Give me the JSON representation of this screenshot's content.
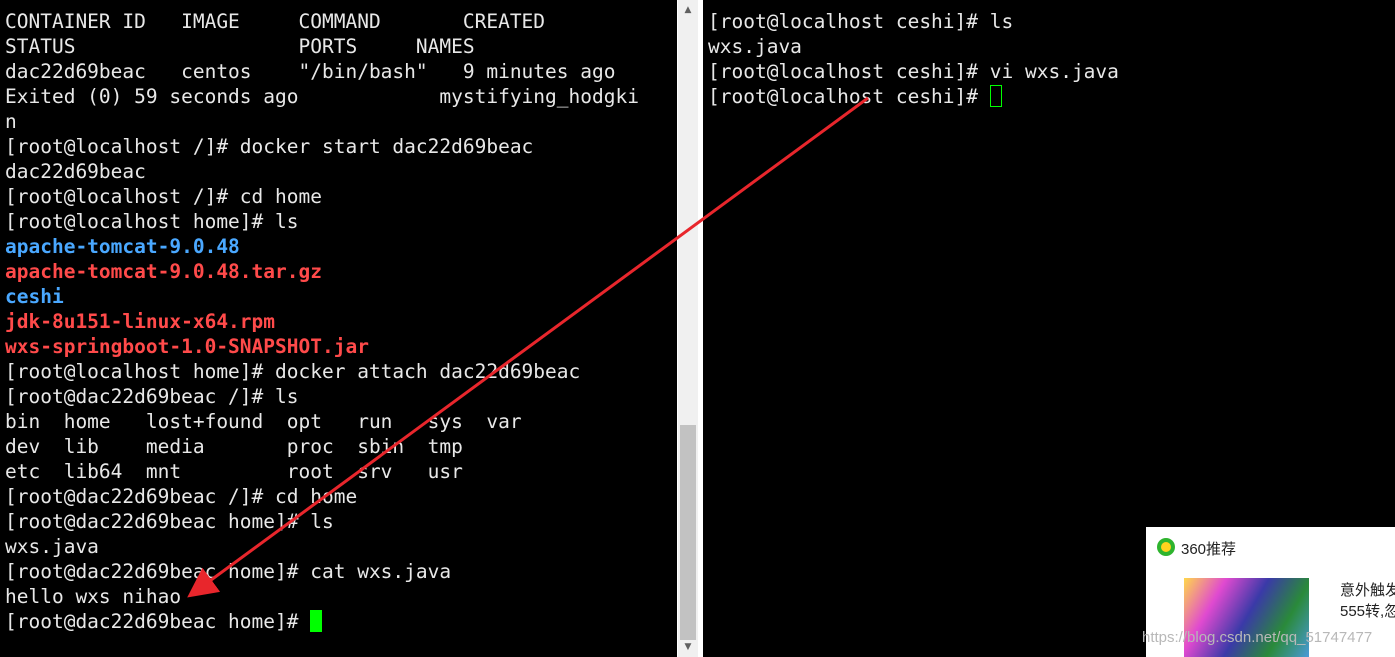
{
  "left_terminal": {
    "lines": [
      {
        "text": "CONTAINER ID   IMAGE     COMMAND       CREATED",
        "style": "normal"
      },
      {
        "text": "STATUS                   PORTS     NAMES",
        "style": "normal"
      },
      {
        "text": "dac22d69beac   centos    \"/bin/bash\"   9 minutes ago",
        "style": "normal"
      },
      {
        "text": "Exited (0) 59 seconds ago            mystifying_hodgki",
        "style": "normal"
      },
      {
        "text": "n",
        "style": "normal"
      },
      {
        "text": "[root@localhost /]# docker start dac22d69beac",
        "style": "normal"
      },
      {
        "text": "dac22d69beac",
        "style": "normal"
      },
      {
        "text": "[root@localhost /]# cd home",
        "style": "normal"
      },
      {
        "text": "[root@localhost home]# ls",
        "style": "normal"
      },
      {
        "text": "apache-tomcat-9.0.48",
        "style": "blue"
      },
      {
        "text": "apache-tomcat-9.0.48.tar.gz",
        "style": "red"
      },
      {
        "text": "ceshi",
        "style": "blue"
      },
      {
        "text": "jdk-8u151-linux-x64.rpm",
        "style": "red"
      },
      {
        "text": "wxs-springboot-1.0-SNAPSHOT.jar",
        "style": "red"
      },
      {
        "text": "[root@localhost home]# docker attach dac22d69beac",
        "style": "normal"
      },
      {
        "text": "[root@dac22d69beac /]# ls",
        "style": "normal"
      },
      {
        "text": "bin  home   lost+found  opt   run   sys  var",
        "style": "normal"
      },
      {
        "text": "dev  lib    media       proc  sbin  tmp",
        "style": "normal"
      },
      {
        "text": "etc  lib64  mnt         root  srv   usr",
        "style": "normal"
      },
      {
        "text": "[root@dac22d69beac /]# cd home",
        "style": "normal"
      },
      {
        "text": "[root@dac22d69beac home]# ls",
        "style": "normal"
      },
      {
        "text": "wxs.java",
        "style": "normal"
      },
      {
        "text": "[root@dac22d69beac home]# cat wxs.java",
        "style": "normal"
      },
      {
        "text": "hello wxs nihao",
        "style": "normal"
      },
      {
        "text": "[root@dac22d69beac home]# ",
        "style": "normal"
      }
    ]
  },
  "right_terminal": {
    "lines": [
      {
        "text": "[root@localhost ceshi]# ls",
        "style": "normal"
      },
      {
        "text": "wxs.java",
        "style": "normal"
      },
      {
        "text": "[root@localhost ceshi]# vi wxs.java",
        "style": "normal"
      },
      {
        "text": "[root@localhost ceshi]# ",
        "style": "normal"
      }
    ]
  },
  "scrollbar": {
    "up_icon": "scroll-up-arrow-icon",
    "down_icon": "scroll-down-arrow-icon"
  },
  "popup": {
    "title": "360推荐",
    "text_line1": "意外触发",
    "text_line2": "555转,忽",
    "logo_icon": "360-logo-icon"
  },
  "watermark": "https://blog.csdn.net/qq_51747477",
  "colors": {
    "terminal_bg": "#000000",
    "text": "#e8e8e8",
    "dir_blue": "#4aa8ff",
    "archive_red": "#ff4a4a",
    "cursor": "#00ff00",
    "arrow": "#e8262c"
  }
}
